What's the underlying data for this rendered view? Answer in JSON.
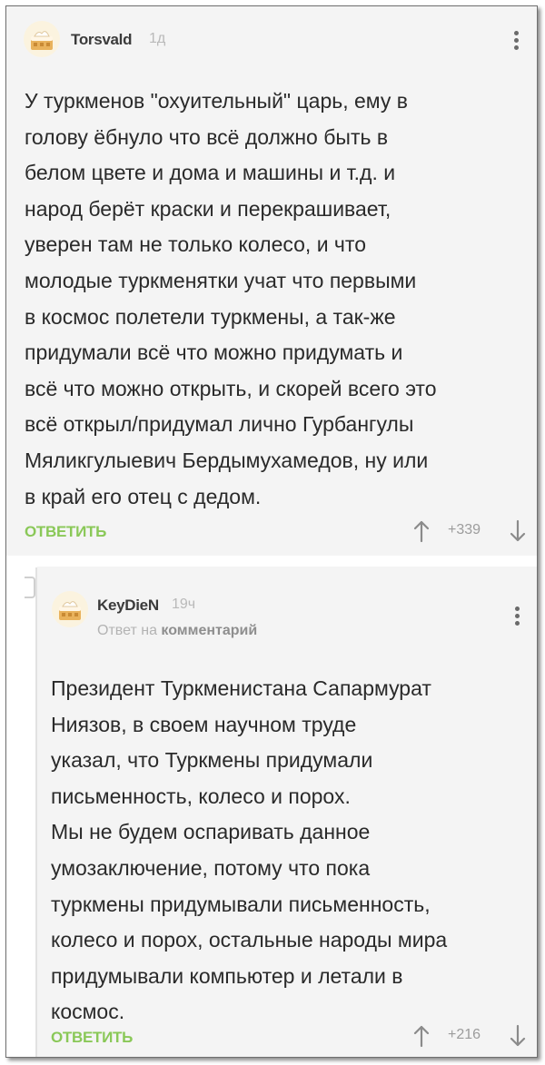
{
  "comments": [
    {
      "author": "Torsvald",
      "time": "1д",
      "text": "У туркменов \"охуительный\" царь, ему в\nголову ёбнуло что всё должно быть в\nбелом цвете и дома и машины и т.д. и\nнарод берёт краски и перекрашивает,\nуверен там не только колесо, и что\nмолодые туркменятки учат что первыми\nв космос  полетели туркмены, а так-же\nпридумали  всё что можно придумать и\nвсё что можно открыть, и скорей всего это\nвсё открыл/придумал лично Гурбангулы\nМяликгулыевич Бердымухамедов, ну или\nв край его отец с дедом.",
      "reply_label": "ОТВЕТИТЬ",
      "score": "+339",
      "avatar_icon": "cake-icon"
    },
    {
      "author": "KeyDieN",
      "time": "19ч",
      "reply_to_prefix": "Ответ на",
      "reply_to_link": "комментарий",
      "text": "Президент Туркменистана Сапармурат\nНиязов, в своем научном труде\nуказал, что Туркмены придумали\nписьменность, колесо и порох.\nМы не будем оспаривать данное\nумозаключение, потому что пока\nтуркмены придумывали письменность,\nколесо и порох, остальные народы мира\nпридумывали компьютер и летали в\nкосмос.",
      "reply_label": "ОТВЕТИТЬ",
      "score": "+216",
      "avatar_icon": "cake-icon"
    }
  ],
  "colors": {
    "accent_green": "#8ac858",
    "card_bg": "#f4f4f4",
    "text": "#2a2a2a",
    "muted": "#b9b9b9"
  }
}
